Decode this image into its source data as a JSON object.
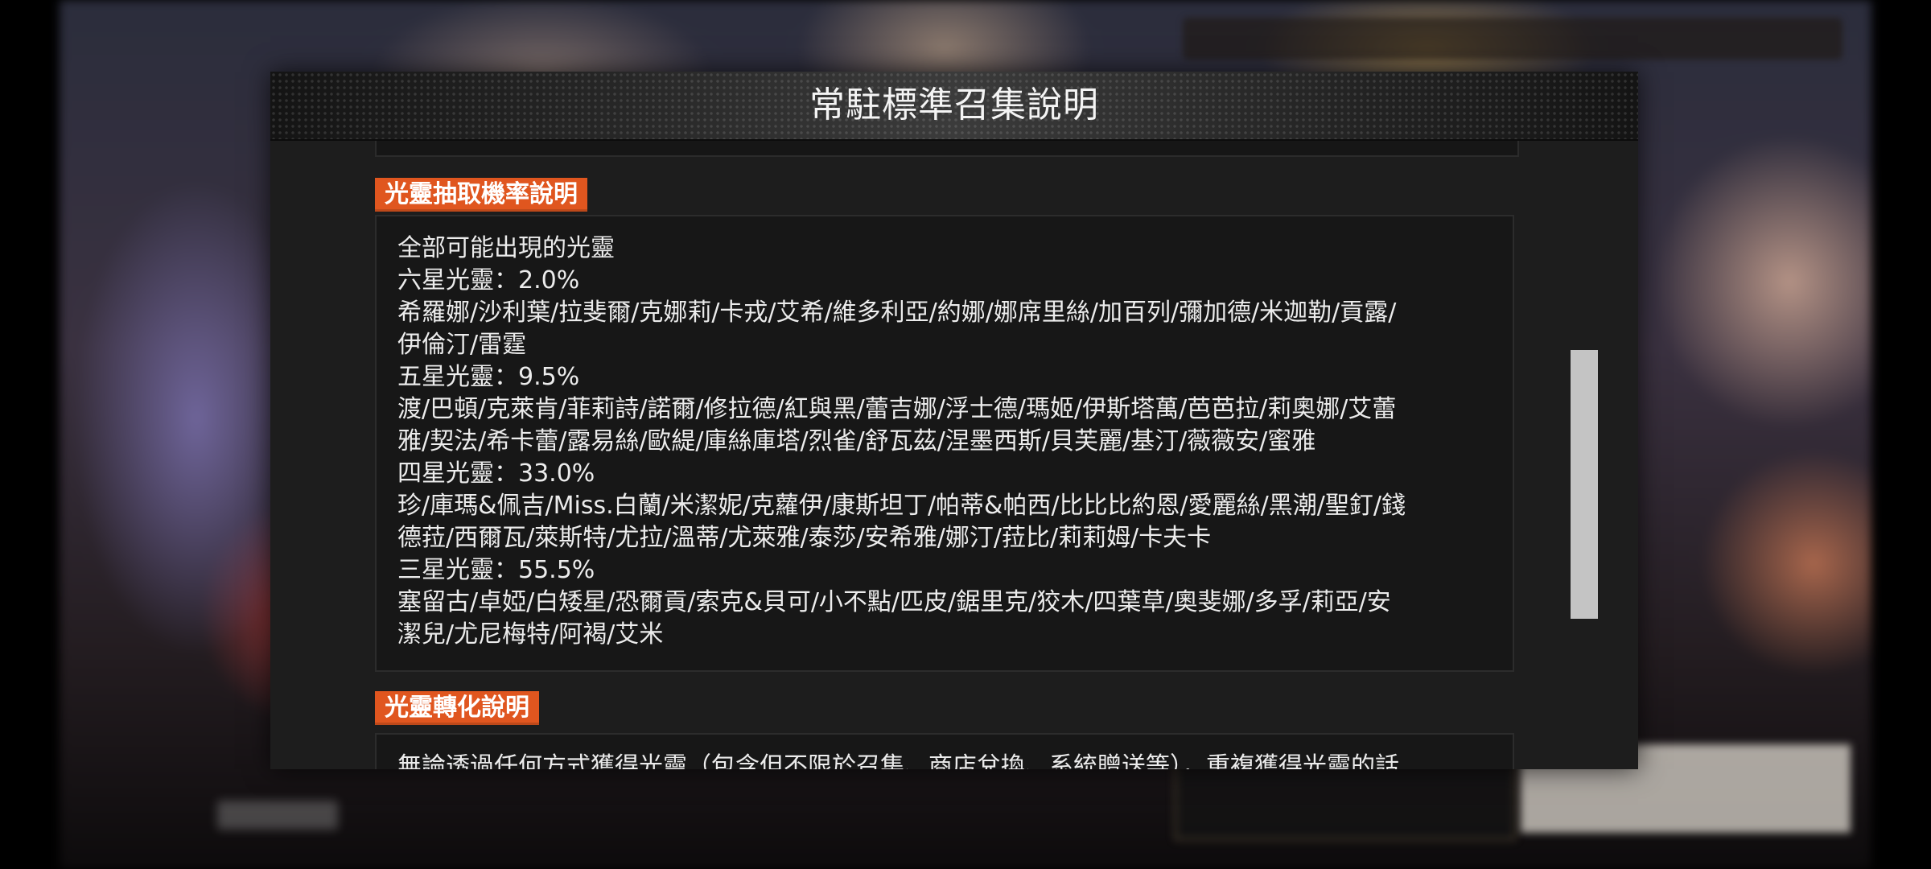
{
  "dialog": {
    "title": "常駐標準召集說明"
  },
  "sections": [
    {
      "heading": "光靈抽取機率說明",
      "lines": [
        "全部可能出現的光靈",
        "六星光靈：2.0%",
        "希羅娜/沙利葉/拉斐爾/克娜莉/卡戎/艾希/維多利亞/約娜/娜席里絲/加百列/彌加德/米迦勒/貢露/",
        "伊倫汀/雷霆",
        "五星光靈：9.5%",
        "渡/巴頓/克萊肯/菲莉詩/諾爾/修拉德/紅與黑/蕾吉娜/浮士德/瑪姬/伊斯塔萬/芭芭拉/莉奧娜/艾蕾",
        "雅/契法/希卡蕾/露易絲/歐緹/庫絲庫塔/烈雀/舒瓦茲/涅墨西斯/貝芙麗/基汀/薇薇安/蜜雅",
        "四星光靈：33.0%",
        "珍/庫瑪&佩吉/Miss.白蘭/米潔妮/克蘿伊/康斯坦丁/帕蒂&帕西/比比比約恩/愛麗絲/黑潮/聖釘/錢",
        "德菈/西爾瓦/萊斯特/尤拉/溫蒂/尤萊雅/泰莎/安希雅/娜汀/菈比/莉莉姆/卡夫卡",
        "三星光靈：55.5%",
        "塞留古/卓婭/白矮星/恐爾貢/索克&貝可/小不點/匹皮/鋸里克/狡木/四葉草/奧斐娜/多孚/莉亞/安",
        "潔兒/尤尼梅特/阿褐/艾米"
      ]
    },
    {
      "heading": "光靈轉化說明",
      "lines": [
        "無論透過任何方式獲得光靈（包含但不限於召集、商店兌換、系統贈送等），重複獲得光靈的話"
      ]
    }
  ]
}
